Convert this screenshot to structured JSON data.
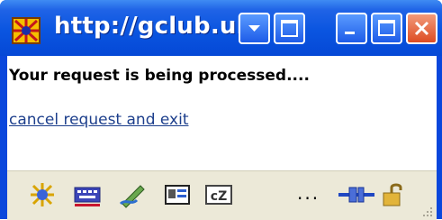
{
  "window": {
    "title": "http://gclub.ub.",
    "icons": {
      "app": "app-flag-icon",
      "dropdown": "dropdown-arrow-icon",
      "restore_alt": "window-icon",
      "minimize": "minimize-icon",
      "maximize": "maximize-icon",
      "close": "close-icon"
    }
  },
  "content": {
    "message": "Your request is being processed....",
    "cancel_link": "cancel request and exit"
  },
  "statusbar": {
    "ellipsis": "...",
    "icons": [
      "globe-sparkle-icon",
      "keyboard-icon",
      "pen-icon",
      "id-card-icon",
      "cz-icon",
      "connector-plug-icon",
      "padlock-icon",
      "resize-grip-icon"
    ]
  },
  "colors": {
    "titlebar": "#0a55e0",
    "close_button": "#dd4c23",
    "link": "#1d3f8c",
    "statusbar": "#ece9d8"
  }
}
